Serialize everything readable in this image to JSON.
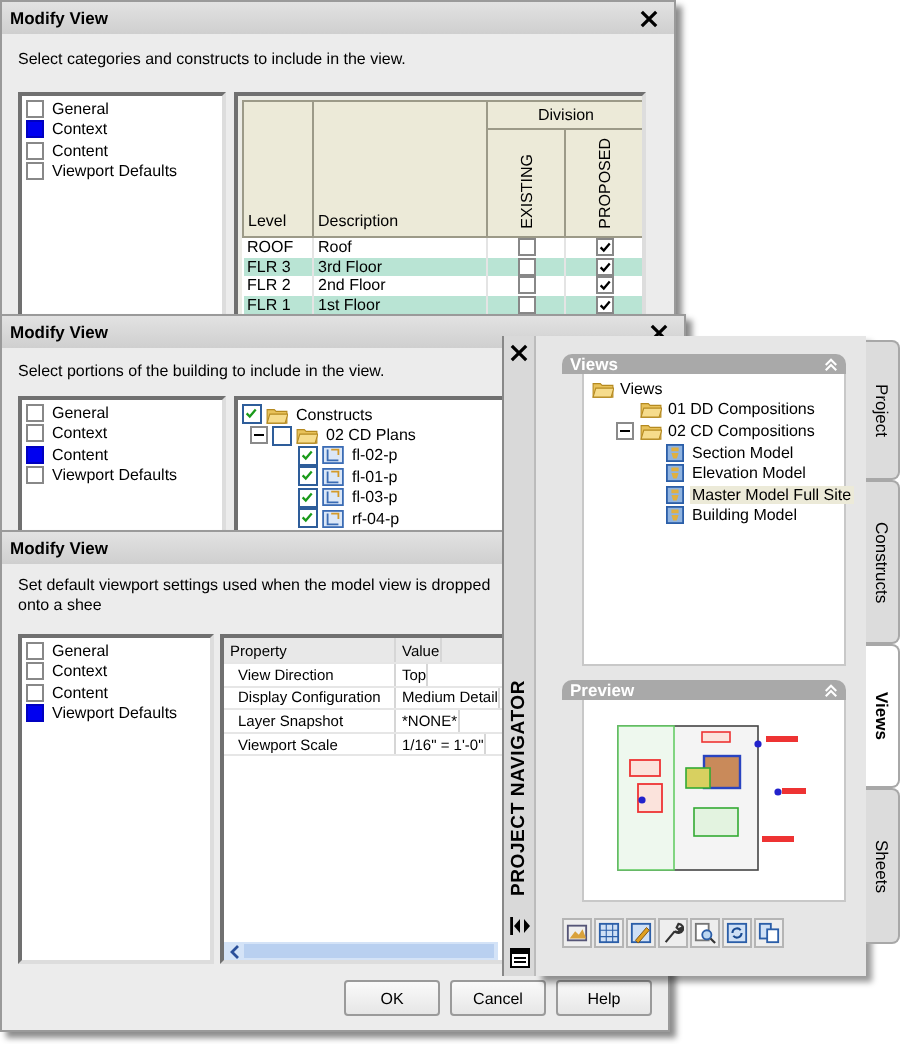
{
  "dialogs": [
    {
      "title": "Modify View",
      "instruction": "Select categories and constructs to include in the view.",
      "categories": [
        {
          "label": "General",
          "selected": false
        },
        {
          "label": "Context",
          "selected": true
        },
        {
          "label": "Content",
          "selected": false
        },
        {
          "label": "Viewport Defaults",
          "selected": false
        }
      ],
      "content": {
        "kind": "levels",
        "columns": [
          "Level",
          "Description"
        ],
        "group": "Division",
        "group_columns": [
          "EXISTING",
          "PROPOSED"
        ],
        "rows": [
          {
            "level": "ROOF",
            "description": "Roof",
            "shaded": false,
            "existing": false,
            "proposed": true
          },
          {
            "level": "FLR 3",
            "description": "3rd Floor",
            "shaded": true,
            "existing": false,
            "proposed": true
          },
          {
            "level": "FLR 2",
            "description": "2nd Floor",
            "shaded": false,
            "existing": false,
            "proposed": true
          },
          {
            "level": "FLR 1",
            "description": "1st Floor",
            "shaded": true,
            "existing": false,
            "proposed": true
          }
        ]
      }
    },
    {
      "title": "Modify View",
      "instruction": "Select portions of the building to include in the view.",
      "categories": [
        {
          "label": "General",
          "selected": false
        },
        {
          "label": "Context",
          "selected": false
        },
        {
          "label": "Content",
          "selected": true
        },
        {
          "label": "Viewport Defaults",
          "selected": false
        }
      ],
      "content": {
        "kind": "tree",
        "items": [
          {
            "label": "Constructs",
            "kind": "folder",
            "checked": true,
            "children": [
              {
                "label": "02 CD Plans",
                "kind": "folder",
                "checked": false,
                "expanded": true,
                "children": [
                  {
                    "label": "fl-02-p",
                    "kind": "construct",
                    "checked": true
                  },
                  {
                    "label": "fl-01-p",
                    "kind": "construct",
                    "checked": true
                  },
                  {
                    "label": "fl-03-p",
                    "kind": "construct",
                    "checked": true
                  },
                  {
                    "label": "rf-04-p",
                    "kind": "construct",
                    "checked": true
                  }
                ]
              }
            ]
          }
        ]
      }
    },
    {
      "title": "Modify View",
      "instruction": "Set default viewport settings used when the model view is dropped onto a shee",
      "categories": [
        {
          "label": "General",
          "selected": false
        },
        {
          "label": "Context",
          "selected": false
        },
        {
          "label": "Content",
          "selected": false
        },
        {
          "label": "Viewport Defaults",
          "selected": true
        }
      ],
      "content": {
        "kind": "properties",
        "columns": [
          "Property",
          "Value"
        ],
        "rows": [
          {
            "property": "View Direction",
            "value": "Top"
          },
          {
            "property": "Display Configuration",
            "value": "Medium Detail"
          },
          {
            "property": "Layer Snapshot",
            "value": "*NONE*"
          },
          {
            "property": "Viewport Scale",
            "value": "1/16\" = 1'-0\""
          }
        ]
      },
      "buttons": [
        "OK",
        "Cancel",
        "Help"
      ]
    }
  ],
  "navigator": {
    "title": "PROJECT NAVIGATOR",
    "views": {
      "title": "Views",
      "tree": [
        {
          "label": "Views",
          "kind": "folder",
          "selected": false,
          "children": [
            {
              "label": "01 DD Compositions",
              "kind": "folder",
              "selected": false
            },
            {
              "label": "02 CD Compositions",
              "kind": "folder",
              "selected": false,
              "expanded": true,
              "children": [
                {
                  "label": "Section Model",
                  "kind": "model",
                  "selected": false
                },
                {
                  "label": "Elevation Model",
                  "kind": "model",
                  "selected": false
                },
                {
                  "label": "Master Model Full Site",
                  "kind": "model",
                  "selected": true
                },
                {
                  "label": "Building Model",
                  "kind": "model",
                  "selected": false
                }
              ]
            }
          ]
        }
      ]
    },
    "preview": {
      "title": "Preview"
    },
    "tabs": [
      {
        "label": "Project",
        "selected": false
      },
      {
        "label": "Constructs",
        "selected": false
      },
      {
        "label": "Views",
        "selected": true
      },
      {
        "label": "Sheets",
        "selected": false
      }
    ]
  }
}
